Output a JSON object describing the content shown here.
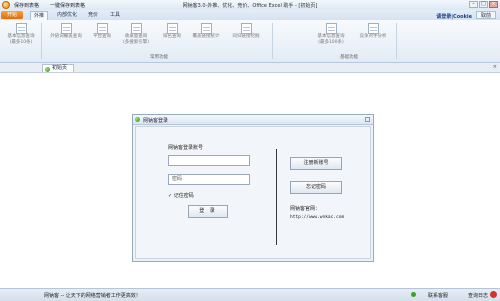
{
  "window": {
    "title": "网钠客3.0-外推、优化、竞价、Office Excel 助手 - [初始页]",
    "quick_access": [
      "保存到表格",
      "一键保存到表格"
    ],
    "controls": [
      "–",
      "□",
      "×"
    ]
  },
  "ribbon": {
    "menu_label": "开始",
    "tabs": [
      {
        "label": "外推",
        "active": true
      },
      {
        "label": "内部优化",
        "active": false
      },
      {
        "label": "竞价",
        "active": false
      },
      {
        "label": "工具",
        "active": false
      }
    ],
    "user_label": "请登录|Cookie",
    "right_button": "取前",
    "buttons": [
      {
        "label": "基本信息查询\n(最多10条)"
      },
      {
        "label": "外链词覆盖查询"
      },
      {
        "label": "平台查询"
      },
      {
        "label": "收录量查询\n(多搜索引擎)"
      },
      {
        "label": "排名查询"
      },
      {
        "label": "覆盖链接统计"
      },
      {
        "label": "同归链接挖掘"
      },
      {
        "label": "基本信息查询\n(最多100条)"
      },
      {
        "label": "竞争对手分析"
      }
    ],
    "groups": [
      "常用功能",
      "基础功能"
    ]
  },
  "doc_tab": {
    "label": "初始页"
  },
  "dialog": {
    "title": "网钠客登录",
    "account_label": "网钠客登录账号",
    "account_value": "",
    "password_placeholder": "密码",
    "remember_label": "记住密码",
    "remember_checked": true,
    "login_button": "登 录",
    "register_button": "注册新账号",
    "forgot_button": "忘记密码",
    "site_label": "网钠客官网：",
    "site_url": "http://www.wnkac.com"
  },
  "status": {
    "left_text": "网钠客 -- 让天下的网络营销者工作更高效！",
    "right_1": "联系客服",
    "right_2": "查询日志"
  },
  "colors": {
    "accent": "#e06b10",
    "titlebar": "#dce8f4",
    "status_icon": "#d2342a"
  }
}
